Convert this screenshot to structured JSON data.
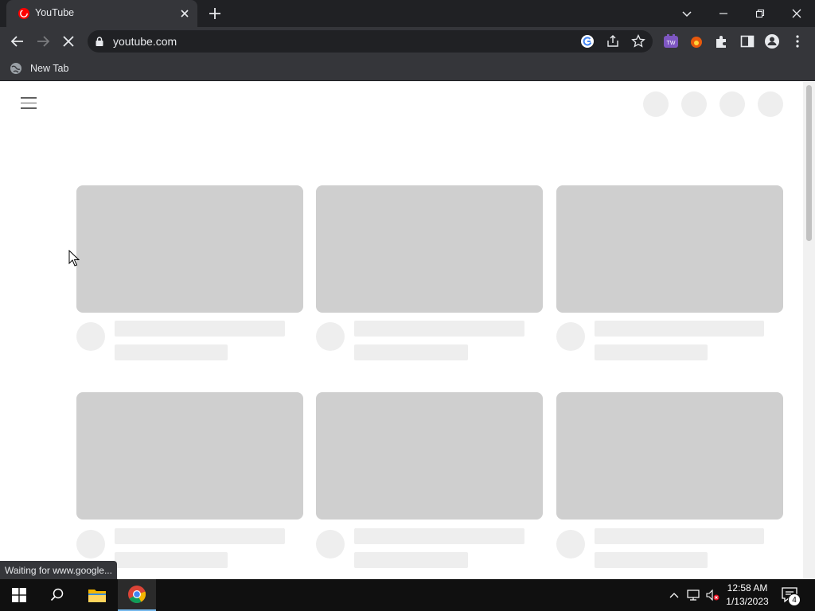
{
  "browser": {
    "tab": {
      "title": "YouTube",
      "favicon": "youtube-icon"
    },
    "address_bar": {
      "url": "youtube.com"
    },
    "bookmarks": [
      {
        "label": "New Tab",
        "icon": "globe-icon"
      }
    ],
    "status_text": "Waiting for www.google..."
  },
  "page": {
    "loading": true,
    "skeleton_rows": 2,
    "skeleton_columns": 3,
    "colors": {
      "skeleton_thumb": "#cfcfcf",
      "skeleton_light": "#eeeeee"
    }
  },
  "taskbar": {
    "time": "12:58 AM",
    "date": "1/13/2023",
    "notification_count": "4",
    "colors": {
      "background": "#101010",
      "accent": "#76b9ed"
    }
  }
}
